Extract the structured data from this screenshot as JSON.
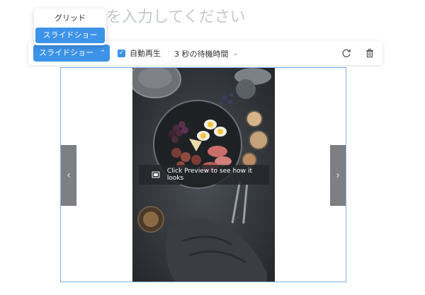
{
  "title_placeholder": "ルを入力してください",
  "layout_dropdown": {
    "options": [
      "グリッド",
      "スライドショー"
    ],
    "selected": "スライドショー"
  },
  "toolbar": {
    "layout_label": "スライドショー",
    "autoplay_label": "自動再生",
    "autoplay_checked": true,
    "interval_label": "3 秒の待機時間",
    "refresh_icon": "refresh-icon",
    "delete_icon": "trash-icon"
  },
  "gallery": {
    "preview_hint": "Click Preview to see how it looks",
    "prev_icon": "chevron-left-icon",
    "next_icon": "chevron-right-icon"
  },
  "colors": {
    "accent": "#3c93e8",
    "placeholder": "#c3c8cf",
    "frame_border": "#7cb3ea",
    "nav_bg": "#7d7f82"
  }
}
